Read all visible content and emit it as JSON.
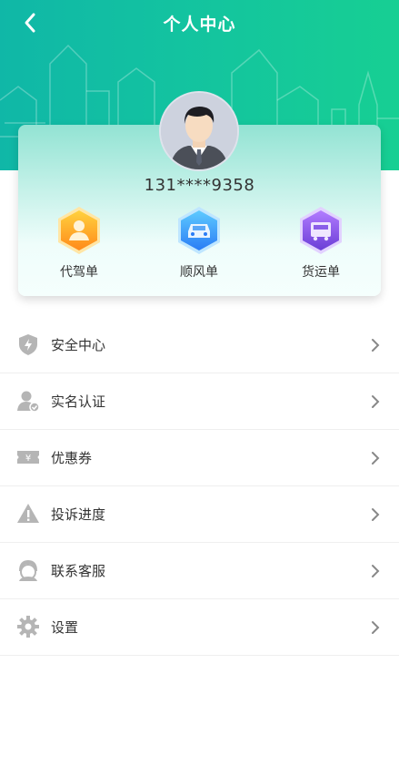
{
  "header": {
    "title": "个人中心",
    "back_icon": "chevron-left-icon",
    "gradient": [
      "#10b7a7",
      "#17cf93"
    ]
  },
  "profile": {
    "phone": "131****9358",
    "avatar_icon": "user-avatar-icon"
  },
  "orders": [
    {
      "label": "代驾单",
      "icon": "driver-icon",
      "color": "#ff9f1a"
    },
    {
      "label": "顺风单",
      "icon": "car-icon",
      "color": "#2f8cff"
    },
    {
      "label": "货运单",
      "icon": "truck-icon",
      "color": "#7a4ee0"
    }
  ],
  "menu": [
    {
      "label": "安全中心",
      "icon": "shield-icon"
    },
    {
      "label": "实名认证",
      "icon": "user-verify-icon"
    },
    {
      "label": "优惠券",
      "icon": "coupon-icon"
    },
    {
      "label": "投诉进度",
      "icon": "warning-icon"
    },
    {
      "label": "联系客服",
      "icon": "customer-service-icon"
    },
    {
      "label": "设置",
      "icon": "gear-icon"
    }
  ],
  "colors": {
    "icon_gray": "#b5b5b5",
    "text": "#333333",
    "divider": "#efefef"
  }
}
